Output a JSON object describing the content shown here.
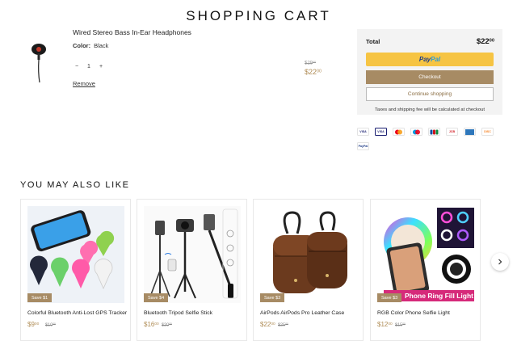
{
  "page": {
    "title": "SHOPPING CART"
  },
  "cart_item": {
    "name": "Wired Stereo Bass In-Ear Headphones",
    "color_label": "Color:",
    "color_value": "Black",
    "quantity": "1",
    "minus": "−",
    "plus": "+",
    "remove": "Remove",
    "price_old_main": "$29",
    "price_old_cents": "00",
    "price_new_main": "$22",
    "price_new_cents": "00"
  },
  "summary": {
    "total_label": "Total",
    "total_main": "$22",
    "total_cents": "00",
    "paypal_a": "Pay",
    "paypal_b": "Pal",
    "checkout": "Checkout",
    "continue": "Continue shopping",
    "tax_note": "Taxes and shipping fee will be calculated at checkout"
  },
  "payment_methods": [
    {
      "label": "VISA",
      "color": "#1a1f71"
    },
    {
      "label": "VISA",
      "color": "#1a1f71"
    },
    {
      "label": "MC",
      "color": "#eb001b"
    },
    {
      "label": "MC",
      "color": "#0099df"
    },
    {
      "label": "JCB",
      "color": "#0b4ea2"
    },
    {
      "label": "JCB",
      "color": "#d0121b"
    },
    {
      "label": "AMEX",
      "color": "#2e77bb"
    },
    {
      "label": "DISC",
      "color": "#f68121"
    },
    {
      "label": "PayPal",
      "color": "#1d3b86"
    }
  ],
  "recommendations": {
    "title": "YOU MAY ALSO LIKE",
    "products": [
      {
        "save": "Save $1",
        "name": "Colorful Bluetooth Anti-Lost GPS Tracker",
        "new_main": "$9",
        "new_cents": "00",
        "old_main": "$10",
        "old_cents": "00"
      },
      {
        "save": "Save $4",
        "name": "Bluetooth Tripod Selfie Stick",
        "new_main": "$16",
        "new_cents": "00",
        "old_main": "$20",
        "old_cents": "00"
      },
      {
        "save": "Save $3",
        "name": "AirPods AirPods Pro Leather Case",
        "new_main": "$22",
        "new_cents": "00",
        "old_main": "$25",
        "old_cents": "00"
      },
      {
        "save": "Save $3",
        "name": "RGB Color Phone Selfie Light",
        "new_main": "$12",
        "new_cents": "00",
        "old_main": "$15",
        "old_cents": "00",
        "banner": "Phone Ring Fill Light"
      }
    ]
  },
  "colors": {
    "accent": "#a78b64",
    "price": "#b08d57",
    "paypal": "#f6c443"
  }
}
